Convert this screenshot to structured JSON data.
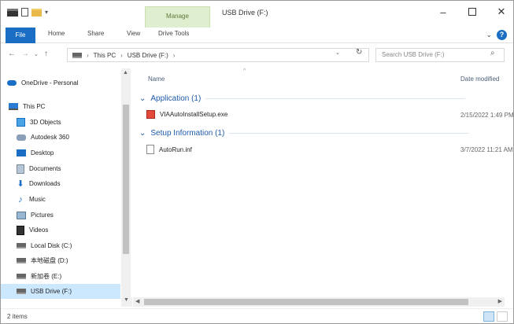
{
  "titlebar": {
    "context_tab": "Manage",
    "title": "USB Drive (F:)",
    "minimize": "–",
    "maximize": "",
    "close": "✕"
  },
  "ribbon": {
    "file": "File",
    "home": "Home",
    "share": "Share",
    "view": "View",
    "drive_tools": "Drive Tools",
    "help": "?",
    "collapse": "⌄"
  },
  "address": {
    "back": "←",
    "forward": "→",
    "recent": "⌄",
    "up": "↑",
    "crumbs": [
      "This PC",
      "USB Drive (F:)"
    ],
    "sep": "›",
    "dropdown": "⌄",
    "refresh": "↻",
    "search_placeholder": "Search USB Drive (F:)",
    "search_icon": "⌕"
  },
  "navpane": {
    "items": [
      {
        "label": "OneDrive - Personal",
        "icon": "cloud-icon"
      },
      {
        "label": "This PC",
        "icon": "computer-icon"
      },
      {
        "label": "3D Objects",
        "icon": "3d-objects-icon"
      },
      {
        "label": "Autodesk 360",
        "icon": "autodesk-icon"
      },
      {
        "label": "Desktop",
        "icon": "desktop-icon"
      },
      {
        "label": "Documents",
        "icon": "documents-icon"
      },
      {
        "label": "Downloads",
        "icon": "downloads-icon"
      },
      {
        "label": "Music",
        "icon": "music-icon"
      },
      {
        "label": "Pictures",
        "icon": "pictures-icon"
      },
      {
        "label": "Videos",
        "icon": "videos-icon"
      },
      {
        "label": "Local Disk (C:)",
        "icon": "disk-icon"
      },
      {
        "label": "本地磁盘 (D:)",
        "icon": "disk-icon"
      },
      {
        "label": "新加卷 (E:)",
        "icon": "disk-icon"
      },
      {
        "label": "USB Drive (F:)",
        "icon": "usb-drive-icon",
        "selected": true
      }
    ],
    "scroll_up": "▲",
    "scroll_down": "▼"
  },
  "content": {
    "columns": {
      "name": "Name",
      "date": "Date modified",
      "sort": "^"
    },
    "groups": [
      {
        "title": "Application (1)",
        "files": [
          {
            "name": "VIAAutoInstallSetup.exe",
            "date": "2/15/2022 1:49 PM",
            "icon": "exe-icon"
          }
        ]
      },
      {
        "title": "Setup Information (1)",
        "files": [
          {
            "name": "AutoRun.inf",
            "date": "3/7/2022 11:21 AM",
            "icon": "inf-file-icon"
          }
        ]
      }
    ]
  },
  "hscroll": {
    "left": "◀",
    "right": "▶"
  },
  "status": {
    "items": "2 items"
  },
  "colors": {
    "accent": "#1a6fc4",
    "context_tab": "#dfeecf",
    "selected": "#cce8ff",
    "group_text": "#1e5aa8"
  }
}
